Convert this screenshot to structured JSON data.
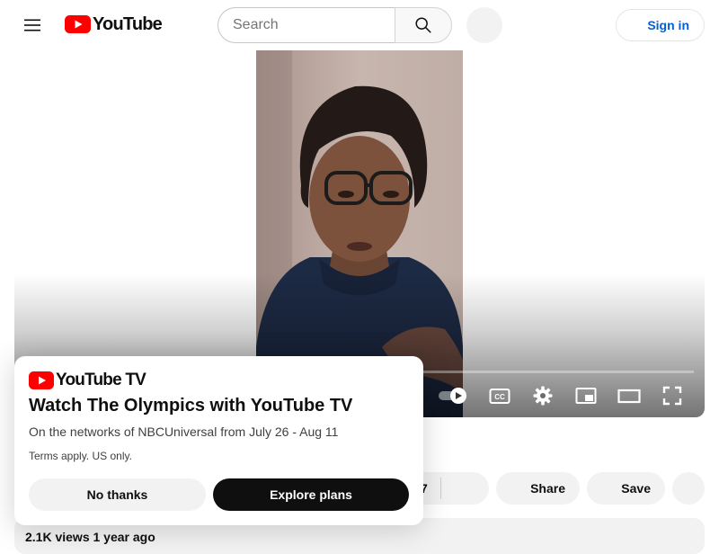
{
  "masthead": {
    "logo_text": "YouTube",
    "search": {
      "placeholder": "Search",
      "value": ""
    },
    "signin_label": "Sign in"
  },
  "player": {
    "progress_fraction": 0.0,
    "controls": [
      "miniplayer-toggle",
      "subtitles",
      "settings",
      "miniplayer",
      "theater-mode",
      "fullscreen"
    ]
  },
  "actions": {
    "count_partial": "7",
    "share_label": "Share",
    "save_label": "Save"
  },
  "description": {
    "meta": "2.1K views  1 year ago"
  },
  "promo": {
    "logo_text": "YouTube TV",
    "title": "Watch The Olympics with YouTube TV",
    "subtitle": "On the networks of NBCUniversal from July 26 - Aug 11",
    "terms": "Terms apply. US only.",
    "no_thanks_label": "No thanks",
    "explore_label": "Explore plans"
  },
  "colors": {
    "brand_red": "#ff0000",
    "link_blue": "#065fd4",
    "pill_bg": "#f2f2f2"
  }
}
